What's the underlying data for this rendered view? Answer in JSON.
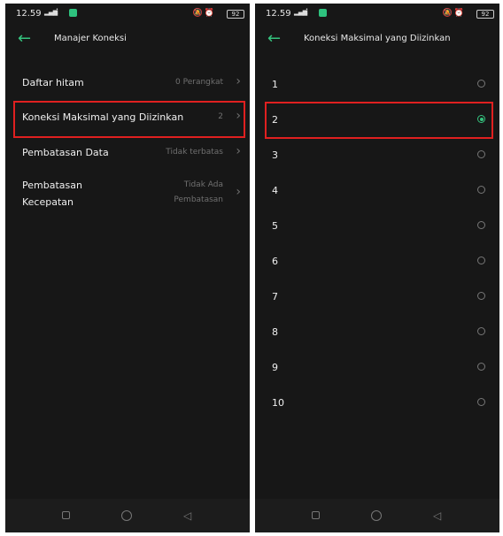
{
  "left": {
    "status": {
      "time": "12.59",
      "battery": "92"
    },
    "title": "Manajer Koneksi",
    "rows": [
      {
        "label": "Daftar hitam",
        "value": "0 Perangkat"
      },
      {
        "label": "Koneksi Maksimal yang Diizinkan",
        "value": "2"
      },
      {
        "label": "Pembatasan Data",
        "value": "Tidak terbatas"
      },
      {
        "label_line1": "Pembatasan",
        "label_line2": "Kecepatan",
        "value_line1": "Tidak Ada",
        "value_line2": "Pembatasan"
      }
    ]
  },
  "right": {
    "status": {
      "time": "12.59",
      "battery": "92"
    },
    "title": "Koneksi Maksimal yang Diizinkan",
    "options": [
      "1",
      "2",
      "3",
      "4",
      "5",
      "6",
      "7",
      "8",
      "9",
      "10"
    ],
    "selected": "2"
  },
  "colors": {
    "accent": "#35c37e",
    "highlight": "#e02020",
    "background": "#171717"
  }
}
